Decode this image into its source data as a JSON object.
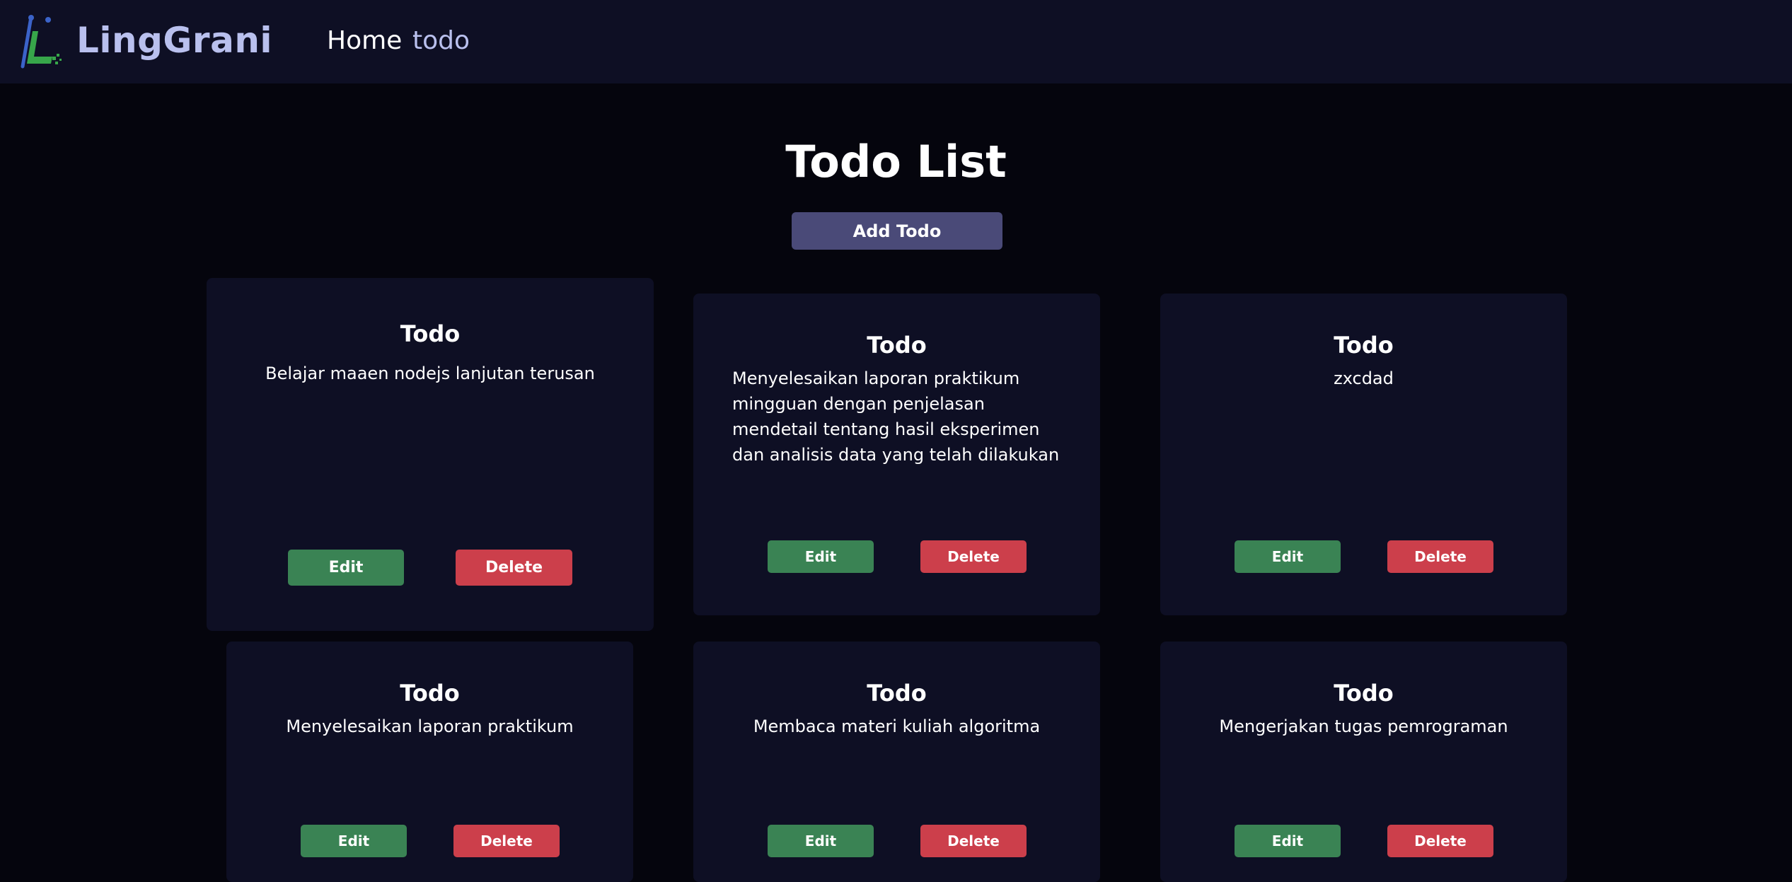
{
  "navbar": {
    "brand": "LingGrani",
    "links": [
      "Home",
      "todo"
    ]
  },
  "page": {
    "title": "Todo List",
    "add_button": "Add Todo"
  },
  "todos": [
    {
      "title": "Todo",
      "description": "Belajar maaen nodejs lanjutan terusan",
      "edit_label": "Edit",
      "delete_label": "Delete"
    },
    {
      "title": "Todo",
      "description": "Menyelesaikan laporan praktikum mingguan dengan penjelasan mendetail tentang hasil eksperimen dan analisis data yang telah dilakukan",
      "edit_label": "Edit",
      "delete_label": "Delete"
    },
    {
      "title": "Todo",
      "description": "zxcdad",
      "edit_label": "Edit",
      "delete_label": "Delete"
    },
    {
      "title": "Todo",
      "description": "Menyelesaikan laporan praktikum",
      "edit_label": "Edit",
      "delete_label": "Delete"
    },
    {
      "title": "Todo",
      "description": "Membaca materi kuliah algoritma",
      "edit_label": "Edit",
      "delete_label": "Delete"
    },
    {
      "title": "Todo",
      "description": "Mengerjakan tugas pemrograman",
      "edit_label": "Edit",
      "delete_label": "Delete"
    }
  ],
  "colors": {
    "background": "#05050d",
    "navbar": "#0e0f24",
    "card": "#0e0f24",
    "brand": "#b9c0ee",
    "add_button": "#4a4a78",
    "edit_button": "#3a8354",
    "delete_button": "#cc3f4b"
  }
}
